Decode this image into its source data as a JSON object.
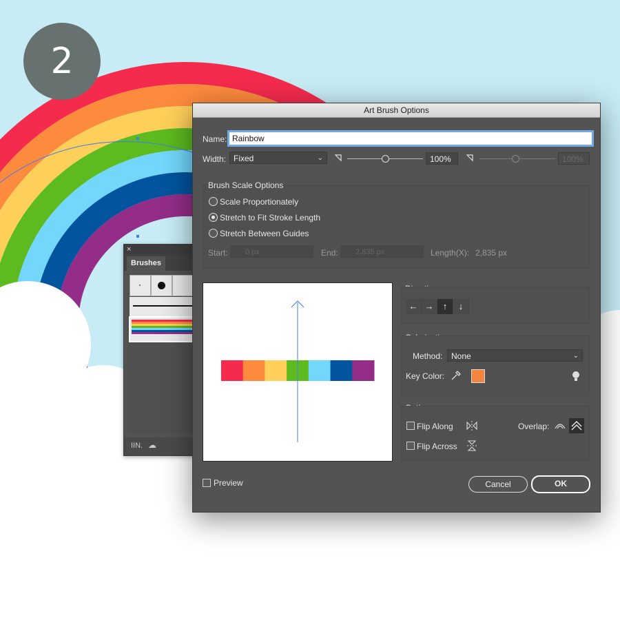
{
  "step_badge": "2",
  "brushes_panel": {
    "close": "×",
    "tab_label": "Brushes",
    "library_icon": "IIN.",
    "footer_icon": "☁"
  },
  "dialog": {
    "title": "Art Brush Options",
    "name_label": "Name:",
    "name_value": "Rainbow",
    "width_label": "Width:",
    "width_value": "Fixed",
    "width_pct": "100%",
    "width_pct_disabled": "100%",
    "width_slider_level": 0.5,
    "scale_group_label": "Brush Scale Options",
    "scale_options": [
      {
        "label": "Scale Proportionately",
        "selected": false
      },
      {
        "label": "Stretch to Fit Stroke Length",
        "selected": true
      },
      {
        "label": "Stretch Between Guides",
        "selected": false
      }
    ],
    "start_label": "Start:",
    "start_value": "0 px",
    "end_label": "End:",
    "end_value": "2,835 px",
    "length_label": "Length(X):",
    "length_value": "2,835 px",
    "direction_label": "Direction:",
    "direction_buttons": [
      "←",
      "→",
      "↑",
      "↓"
    ],
    "direction_selected": "↑",
    "colorization_label": "Colorization",
    "method_label": "Method:",
    "method_value": "None",
    "key_color_label": "Key Color:",
    "key_color": "#f5853c",
    "options_label": "Options",
    "flip_along_label": "Flip Along",
    "flip_across_label": "Flip Across",
    "overlap_label": "Overlap:",
    "preview_label": "Preview",
    "cancel_label": "Cancel",
    "ok_label": "OK"
  },
  "rainbow_colors": [
    "#f52b4e",
    "#fd8b3d",
    "#fed059",
    "#5dba1f",
    "#72d7fb",
    "#01549d",
    "#932d87"
  ],
  "colors": {
    "sky": "#c7ecf5",
    "dialog_bg": "#535353",
    "selection_blue": "#3f7bf3"
  }
}
